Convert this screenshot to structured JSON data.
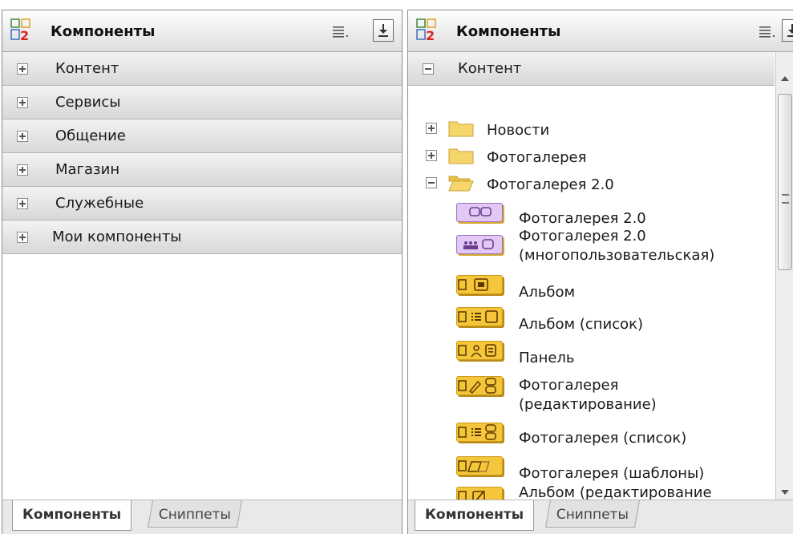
{
  "header": {
    "title": "Компоненты"
  },
  "left_accordion": [
    {
      "label": "Контент"
    },
    {
      "label": "Сервисы"
    },
    {
      "label": "Общение"
    },
    {
      "label": "Магазин"
    },
    {
      "label": "Служебные"
    },
    {
      "label": "Мои компоненты"
    }
  ],
  "right_accordion": {
    "label": "Контент"
  },
  "tree": {
    "folders": [
      {
        "label": "Новости"
      },
      {
        "label": "Фотогалерея"
      },
      {
        "label": "Фотогалерея 2.0"
      }
    ],
    "components": [
      {
        "lines": [
          "Фотогалерея 2.0"
        ]
      },
      {
        "lines": [
          "Фотогалерея 2.0",
          "(многопользовательская)"
        ]
      },
      {
        "lines": [
          "Альбом"
        ]
      },
      {
        "lines": [
          "Альбом (список)"
        ]
      },
      {
        "lines": [
          "Панель"
        ]
      },
      {
        "lines": [
          "Фотогалерея",
          "(редактирование)"
        ]
      },
      {
        "lines": [
          "Фотогалерея (список)"
        ]
      },
      {
        "lines": [
          "Фотогалерея (шаблоны)"
        ]
      },
      {
        "lines": [
          "Альбом (редактирование"
        ]
      }
    ]
  },
  "tabs": {
    "active": "Компоненты",
    "inactive": "Сниппеты"
  }
}
